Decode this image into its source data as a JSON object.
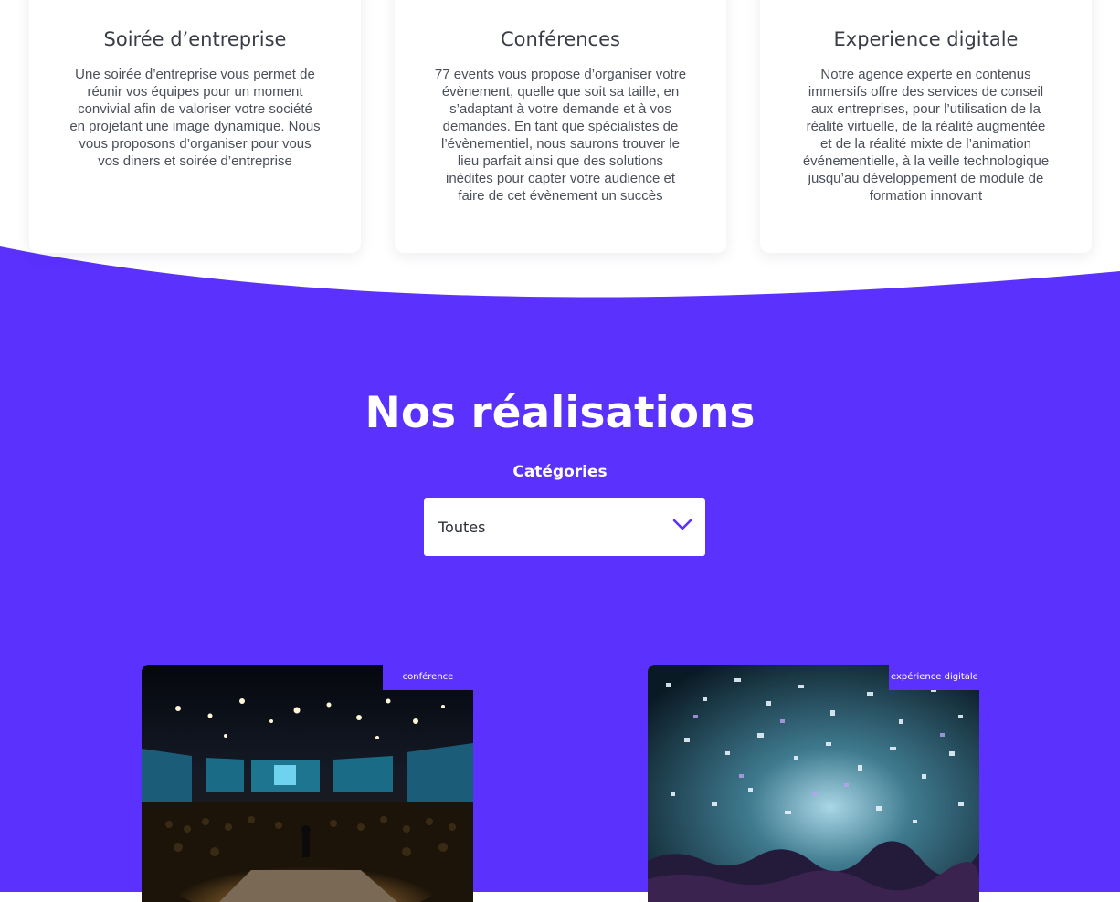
{
  "colors": {
    "brand_purple": "#5a31fd",
    "card_background": "#ffffff",
    "heading_text": "#383d47",
    "body_text": "#4a4f5a"
  },
  "services": [
    {
      "title": "Soirée d’entreprise",
      "description": "Une soirée d’entreprise vous permet de réunir vos équipes pour un moment convivial afin de valoriser votre société en projetant une image dynamique. Nous vous proposons d’organiser pour vous vos diners et soirée d’entreprise"
    },
    {
      "title": "Conférences",
      "description": "77 events vous propose d’organiser votre évènement, quelle que soit sa taille, en s’adaptant à votre demande et à vos demandes. En tant que spécialistes de l’évènementiel, nous saurons trouver le lieu parfait ainsi que des solutions inédites pour capter votre audience et faire de cet évènement un succès"
    },
    {
      "title": "Experience digitale",
      "description": "Notre agence experte en contenus immersifs offre des services de conseil aux entreprises, pour l’utilisation de la réalité virtuelle, de la réalité augmentée et de la réalité mixte de l’animation événementielle, à la veille technologique jusqu’au développement de module de formation innovant"
    }
  ],
  "realisations": {
    "title": "Nos réalisations",
    "filter_label": "Catégories",
    "filter_selected": "Toutes",
    "filter_icon": "chevron-down-icon",
    "projects": [
      {
        "category": "conférence",
        "image": "conference-stage-photo"
      },
      {
        "category": "expérience digitale",
        "image": "confetti-concert-photo"
      }
    ]
  }
}
